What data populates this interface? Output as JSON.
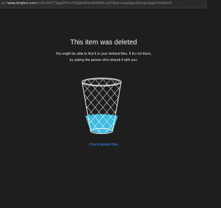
{
  "browser": {
    "url_prefix": "ps://",
    "url_host": "www.dropbox.com",
    "url_rest": "/scl/fo/1k6T7dgp4rH7rcTMq9ekWmnNWt3h6.zip?rlkey=sxsdxlgzr2b1sakcipgjd7mn&dl=0"
  },
  "deleted_notice": {
    "title": "This item was deleted",
    "message_line1": "You might be able to find it in your deleted files. If it's not there,",
    "message_line2": "try asking the person who shared it with you.",
    "link_label": "Check deleted files"
  },
  "illustration": {
    "icon": "wastebasket-icon",
    "fill_color": "#3ec4ef",
    "line_color": "#ffffff"
  }
}
